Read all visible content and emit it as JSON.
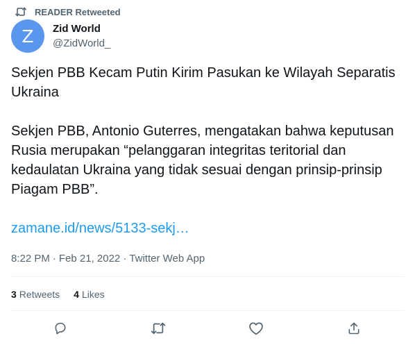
{
  "retweet_context": {
    "label": "READER Retweeted",
    "icon": "retweet-icon"
  },
  "author": {
    "avatar_initial": "Z",
    "avatar_color": "#5a95ee",
    "name": "Zid World",
    "handle": "@ZidWorld_"
  },
  "tweet": {
    "paragraphs": [
      "Sekjen PBB Kecam Putin Kirim Pasukan ke Wilayah Separatis Ukraina",
      "Sekjen PBB, Antonio Guterres, mengatakan bahwa keputusan Rusia merupakan “pelanggaran integritas teritorial dan kedaulatan Ukraina yang tidak sesuai dengan prinsip-prinsip Piagam PBB”."
    ],
    "link_text": "zamane.id/news/5133-sekj…",
    "link_color": "#1d9bf0"
  },
  "meta": {
    "time": "8:22 PM",
    "date": "Feb 21, 2022",
    "source": "Twitter Web App",
    "separator": "·"
  },
  "stats": {
    "retweets_count": "3",
    "retweets_label": "Retweets",
    "likes_count": "4",
    "likes_label": "Likes"
  },
  "actions": [
    {
      "name": "reply-icon"
    },
    {
      "name": "retweet-icon"
    },
    {
      "name": "like-icon"
    },
    {
      "name": "share-icon"
    }
  ]
}
